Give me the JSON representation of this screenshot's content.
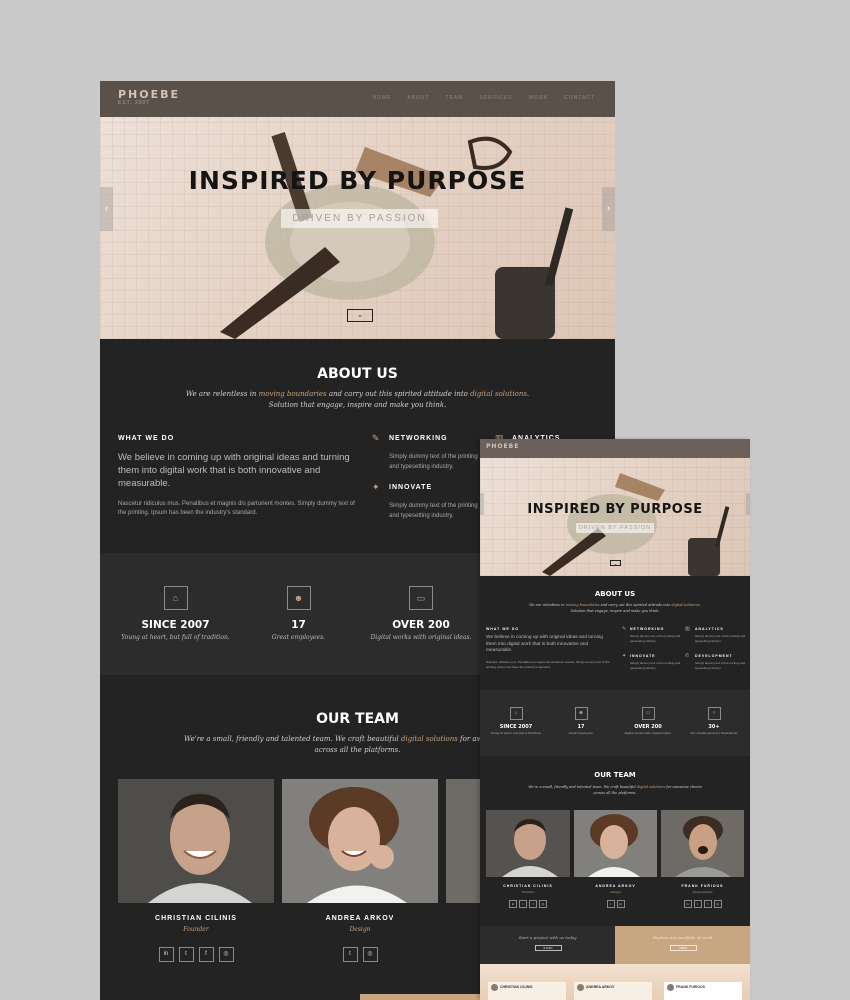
{
  "brand": {
    "name": "PHOEBE",
    "tagline": "EST. 2007"
  },
  "nav": {
    "links": [
      "HOME",
      "ABOUT",
      "TEAM",
      "SERVICES",
      "WORK",
      "CONTACT"
    ]
  },
  "hero": {
    "title": "INSPIRED BY PURPOSE",
    "subtitle": "DRIVEN BY PASSION",
    "prev": "‹",
    "next": "›",
    "scroll": "⌄"
  },
  "about": {
    "title": "ABOUT US",
    "lead_pre": "We are relentless in ",
    "lead_acc1": "moving boundaries",
    "lead_mid": " and carry out this spirited attitude into ",
    "lead_acc2": "digital solutions",
    "lead_post": ".",
    "lead_line2": "Solution that engage, inspire and make you think.",
    "what_we_do": {
      "heading": "WHAT WE DO",
      "body": "We believe in coming up with original ideas and turning them into digital work that is both innovative and measurable.",
      "detail": "Nascetur ridiculus mus. Penatibus et magnis dis parturient montes. Simply dummy text of the printing. Ipsum has been the industry's standard."
    },
    "features": [
      {
        "icon": "✎",
        "icon_name": "pencil-icon",
        "title": "NETWORKING",
        "text": "Simply dummy text of the printing and typesetting industry."
      },
      {
        "icon": "✦",
        "icon_name": "wand-icon",
        "title": "INNOVATE",
        "text": "Simply dummy text of the printing and typesetting industry."
      },
      {
        "icon": "▥",
        "icon_name": "chart-icon",
        "title": "ANALYTICS",
        "text": "Simply dummy text of the printing and typesetting industry."
      },
      {
        "icon": "✆",
        "icon_name": "phone-icon",
        "title": "DEVELOPMENT",
        "text": "Simply dummy text of the printing and typesetting industry."
      }
    ]
  },
  "stats": [
    {
      "icon": "⌂",
      "icon_name": "gift-icon",
      "value": "SINCE 2007",
      "caption": "Young at heart, but full of tradition."
    },
    {
      "icon": "☻",
      "icon_name": "people-icon",
      "value": "17",
      "caption": "Great employees."
    },
    {
      "icon": "▭",
      "icon_name": "laptop-icon",
      "value": "OVER 200",
      "caption": "Digital works with original ideas."
    },
    {
      "icon": "♆",
      "icon_name": "trophy-icon",
      "value": "30+",
      "caption": "Our results speak for themselves."
    }
  ],
  "team": {
    "title": "OUR TEAM",
    "lead_pre": "We're a small, friendly and talented team. We craft beautiful ",
    "lead_acc": "digital solutions",
    "lead_post": " for awesome clients",
    "lead_line2": "across all the platforms.",
    "members": [
      {
        "name": "CHRISTIAN CILINIS",
        "role": "Founder",
        "socials": [
          "in",
          "t",
          "f",
          "◎"
        ]
      },
      {
        "name": "ANDREA ARKOV",
        "role": "Design",
        "socials": [
          "t",
          "◎"
        ]
      },
      {
        "name": "FRANK FURIOUS",
        "role": "Development",
        "socials": [
          "in",
          "t",
          "f",
          "◎"
        ]
      }
    ]
  },
  "cta": {
    "left_text": "Start a project with us today",
    "left_button": "START",
    "right_text": "Explore our portfolio of work",
    "right_button": "VIEW"
  },
  "colors": {
    "accent": "#c8a07c",
    "dark": "#232323",
    "stats_bg": "#2c2c2c",
    "nav": "#5b514b"
  }
}
